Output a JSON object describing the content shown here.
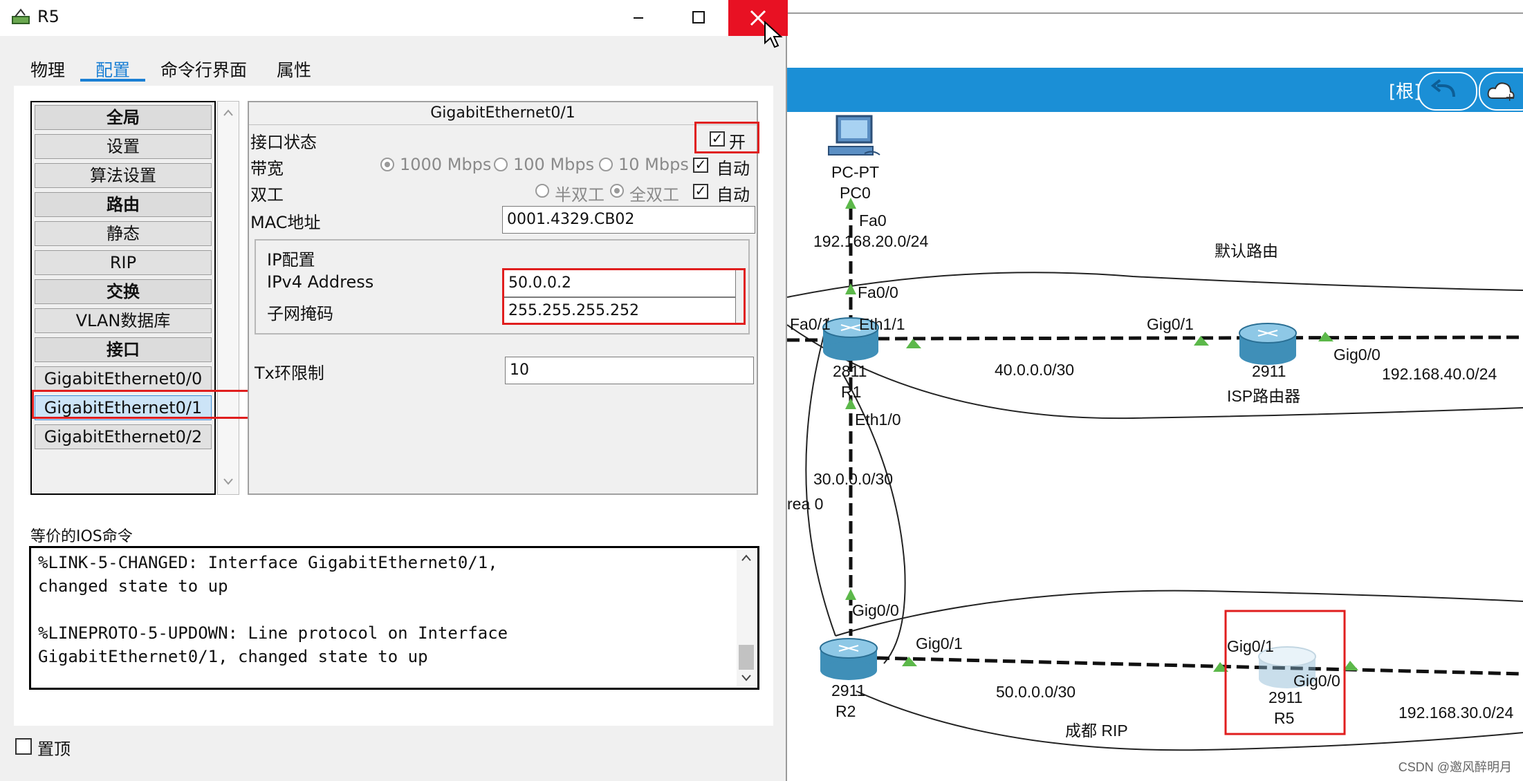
{
  "window": {
    "title": "R5",
    "minimize_icon": "minimize-icon",
    "maximize_icon": "maximize-icon",
    "close_icon": "close-icon"
  },
  "tabs": [
    {
      "label": "物理"
    },
    {
      "label": "配置",
      "selected": true
    },
    {
      "label": "命令行界面"
    },
    {
      "label": "属性"
    }
  ],
  "nav": {
    "items": [
      {
        "label": "全局",
        "header": true
      },
      {
        "label": "设置"
      },
      {
        "label": "算法设置"
      },
      {
        "label": "路由",
        "header": true
      },
      {
        "label": "静态"
      },
      {
        "label": "RIP"
      },
      {
        "label": "交换",
        "header": true
      },
      {
        "label": "VLAN数据库"
      },
      {
        "label": "接口",
        "header": true
      },
      {
        "label": "GigabitEthernet0/0"
      },
      {
        "label": "GigabitEthernet0/1",
        "selected": true
      },
      {
        "label": "GigabitEthernet0/2"
      }
    ]
  },
  "interface": {
    "title": "GigabitEthernet0/1",
    "port_status_label": "接口状态",
    "port_status_on_label": "开",
    "port_status_on": true,
    "bandwidth_label": "带宽",
    "bandwidth_options": [
      "1000 Mbps",
      "100 Mbps",
      "10 Mbps"
    ],
    "bandwidth_auto_label": "自动",
    "duplex_label": "双工",
    "duplex_options": [
      "半双工",
      "全双工"
    ],
    "duplex_auto_label": "自动",
    "mac_label": "MAC地址",
    "mac_value": "0001.4329.CB02",
    "ip_group_label": "IP配置",
    "ipv4_label": "IPv4 Address",
    "ipv4_value": "50.0.0.2",
    "subnet_label": "子网掩码",
    "subnet_value": "255.255.255.252",
    "tx_ring_label": "Tx环限制",
    "tx_ring_value": "10"
  },
  "ios": {
    "label": "等价的IOS命令",
    "text": "%LINK-5-CHANGED: Interface GigabitEthernet0/1,\nchanged state to up\n\n%LINEPROTO-5-UPDOWN: Line protocol on Interface\nGigabitEthernet0/1, changed state to up"
  },
  "pin_label": "置顶",
  "topology": {
    "root_label": "[根]",
    "labels": {
      "pc_type": "PC-PT",
      "pc_name": "PC0",
      "fa0": "Fa0",
      "net_20": "192.168.20.0/24",
      "default_route": "默认路由",
      "fa0_0": "Fa0/0",
      "fa0_1": "Fa0/1",
      "eth1_1": "Eth1/1",
      "gig0_1_isp": "Gig0/1",
      "r1_model": "2811",
      "r1_name": "R1",
      "net_40": "40.0.0.0/30",
      "isp_model": "2911",
      "isp_name": "ISP路由器",
      "gig0_0_isp": "Gig0/0",
      "net_40_lan": "192.168.40.0/24",
      "eth1_0": "Eth1/0",
      "net_30": "30.0.0.0/30",
      "area0": "rea 0",
      "gig0_0_r2": "Gig0/0",
      "gig0_1_r2": "Gig0/1",
      "r2_model": "2911",
      "r2_name": "R2",
      "net_50": "50.0.0.0/30",
      "chengdu_rip": "成都   RIP",
      "gig0_1_r5": "Gig0/1",
      "gig0_0_r5": "Gig0/0",
      "r5_model": "2911",
      "r5_name": "R5",
      "net_30_lan": "192.168.30.0/24"
    }
  },
  "watermark": "CSDN @邀风醉明月",
  "colors": {
    "accent": "#1a7fd4",
    "toolbar": "#1b8fd6",
    "close": "#e81123",
    "highlight": "#e01e1e",
    "link_up": "#5cb84a"
  }
}
